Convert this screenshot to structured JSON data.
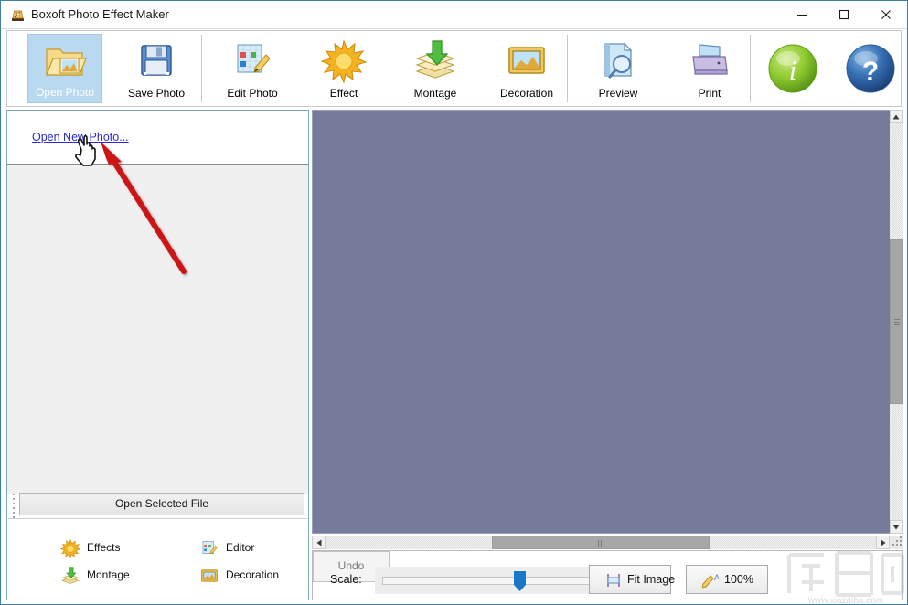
{
  "window": {
    "title": "Boxoft Photo Effect Maker",
    "icon": "app-icon",
    "controls": {
      "minimize": "minimize-icon",
      "maximize": "maximize-icon",
      "close": "close-icon"
    }
  },
  "toolbar": {
    "items": [
      {
        "label": "Open Photo",
        "icon": "open-folder-photo-icon",
        "selected": true
      },
      {
        "label": "Save Photo",
        "icon": "floppy-disk-icon",
        "selected": false
      },
      {
        "label": "Edit Photo",
        "icon": "palette-pencil-icon",
        "selected": false
      },
      {
        "label": "Effect",
        "icon": "sun-burst-icon",
        "selected": false
      },
      {
        "label": "Montage",
        "icon": "layers-down-arrow-icon",
        "selected": false
      },
      {
        "label": "Decoration",
        "icon": "framed-picture-icon",
        "selected": false
      },
      {
        "label": "Preview",
        "icon": "page-magnifier-icon",
        "selected": false
      },
      {
        "label": "Print",
        "icon": "printer-icon",
        "selected": false
      }
    ],
    "round_buttons": [
      {
        "name": "about-info-button",
        "icon": "info-circle-icon",
        "glyph": "i",
        "color": "#7cb82f"
      },
      {
        "name": "help-button",
        "icon": "question-circle-icon",
        "glyph": "?",
        "color": "#2a5f9e"
      }
    ]
  },
  "left_panel": {
    "open_new_link": "Open New Photo...",
    "open_selected_button": "Open Selected File",
    "shortcuts": [
      {
        "label": "Effects",
        "icon": "sun-burst-icon"
      },
      {
        "label": "Editor",
        "icon": "palette-pencil-icon"
      },
      {
        "label": "Montage",
        "icon": "layers-down-arrow-icon"
      },
      {
        "label": "Decoration",
        "icon": "framed-picture-icon"
      }
    ]
  },
  "canvas": {
    "background_color": "#767b9b"
  },
  "bottom_bar": {
    "scale_label": "Scale:",
    "fit_image_button": "Fit Image",
    "zoom_button": "100%",
    "undo_button": "Undo"
  },
  "watermark": {
    "url_text": "www.xiazaiba.com"
  },
  "annotation": {
    "arrow_color": "#cc1414",
    "cursor": "hand-pointer-cursor"
  },
  "colors": {
    "accent_blue": "#1a76c6",
    "selected_tool_bg": "#b9d9f0",
    "link_blue": "#2a2ad0",
    "canvas_slate": "#767b9b",
    "window_border": "#3f7fa5"
  }
}
